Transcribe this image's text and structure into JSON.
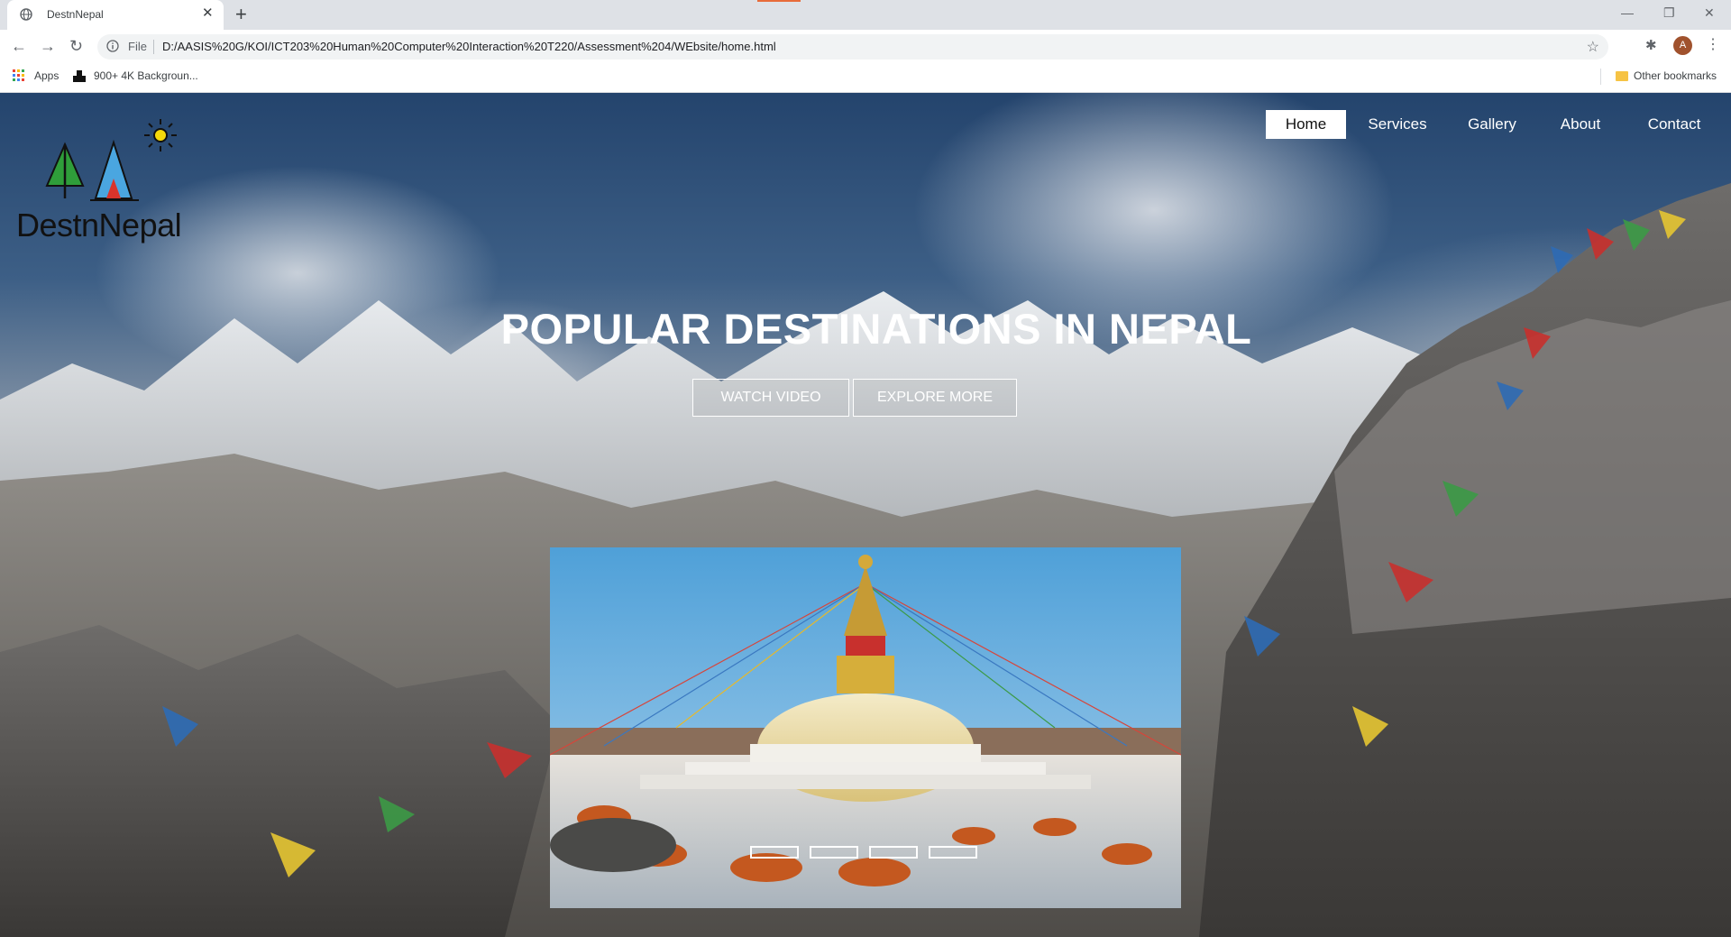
{
  "browser": {
    "tab_title": "DestnNepal",
    "address": {
      "scheme_label": "File",
      "url": "D:/AASIS%20G/KOI/ICT203%20Human%20Computer%20Interaction%20T220/Assessment%204/WEbsite/home.html"
    },
    "profile_initial": "A",
    "bookmarks": {
      "apps_label": "Apps",
      "item1_label": "900+ 4K Backgroun...",
      "other_label": "Other bookmarks"
    }
  },
  "site": {
    "logo_text": "DestnNepal",
    "nav": [
      {
        "label": "Home",
        "active": true
      },
      {
        "label": "Services",
        "active": false
      },
      {
        "label": "Gallery",
        "active": false
      },
      {
        "label": "About",
        "active": false
      },
      {
        "label": "Contact",
        "active": false
      }
    ],
    "hero_title": "POPULAR DESTINATIONS IN NEPAL",
    "buttons": {
      "watch_video": "WATCH VIDEO",
      "explore_more": "EXPLORE MORE"
    },
    "slider": {
      "slide_count": 4
    }
  },
  "colors": {
    "nav_active_bg": "#ffffff",
    "accent": "#e86b3a"
  }
}
